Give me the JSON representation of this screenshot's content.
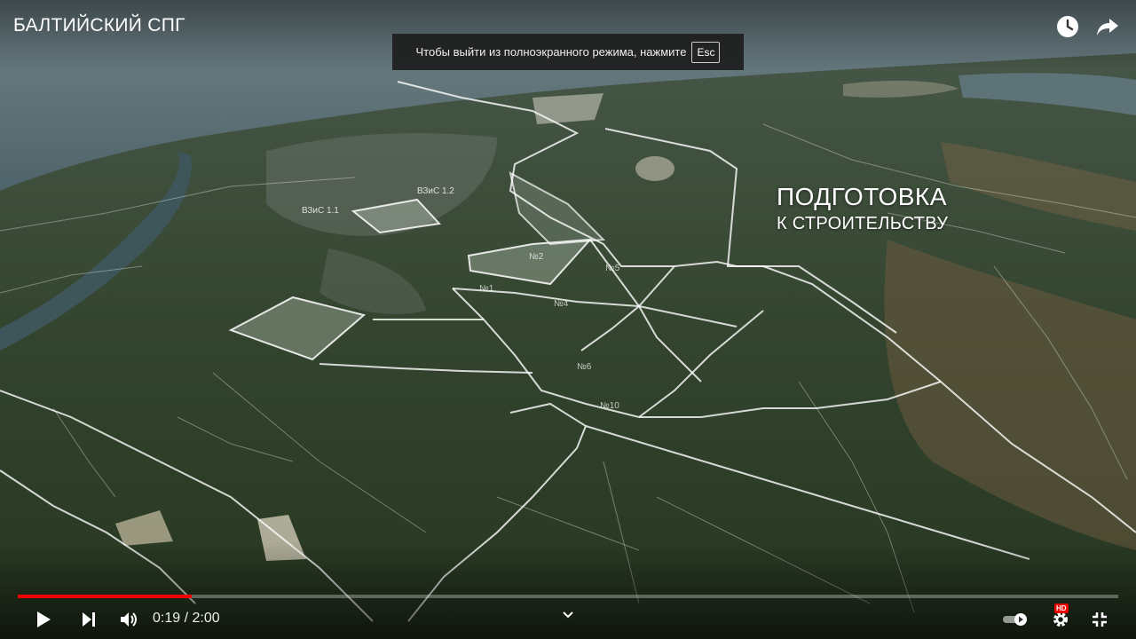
{
  "video": {
    "title": "БАЛТИЙСКИЙ СПГ",
    "progress": 0.158,
    "time_current": "0:19",
    "time_separator": " / ",
    "time_total": "2:00"
  },
  "fullscreen_notice": {
    "text": "Чтобы выйти из полноэкранного режима, нажмите",
    "key": "Esc"
  },
  "overlay": {
    "line1": "ПОДГОТОВКА",
    "line2": "К СТРОИТЕЛЬСТВУ"
  },
  "map_labels": {
    "vzis_1_1": "ВЗиС 1.1",
    "vzis_1_2": "ВЗиС 1.2",
    "zone_1": "№1",
    "zone_2": "№2",
    "zone_4": "№4",
    "zone_5": "№5",
    "zone_6": "№6",
    "zone_10": "№10"
  },
  "icons": {
    "watch_later": "clock-icon",
    "share": "share-icon",
    "play": "play-icon",
    "next": "next-icon",
    "volume": "volume-icon",
    "chevron": "chevron-down-icon",
    "autoplay": "autoplay-toggle-icon",
    "settings": "gear-icon",
    "fullscreen_exit": "exit-fullscreen-icon"
  },
  "colors": {
    "progress": "#ee0000",
    "hd_badge": "#ee0000"
  }
}
